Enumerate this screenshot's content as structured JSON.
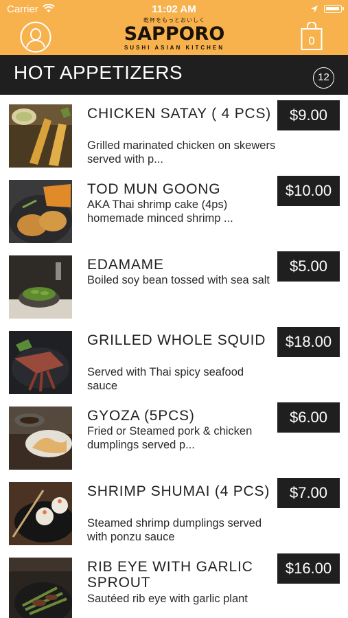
{
  "status_bar": {
    "carrier": "Carrier",
    "time": "11:02 AM"
  },
  "header": {
    "logo_jp": "乾杯をもっとおいしく",
    "logo_main": "SAPPORO",
    "logo_sub": "SUSHI ASIAN KITCHEN"
  },
  "section": {
    "title": "HOT APPETIZERS",
    "count": "12"
  },
  "items": [
    {
      "name": "CHICKEN SATAY ( 4 PCS)",
      "desc": "Grilled marinated chicken on skewers served with p...",
      "price": "$9.00"
    },
    {
      "name": "TOD MUN GOONG",
      "desc": "AKA Thai shrimp cake (4ps) homemade minced shrimp ...",
      "price": "$10.00"
    },
    {
      "name": "EDAMAME",
      "desc": "Boiled soy bean tossed with sea salt",
      "price": "$5.00"
    },
    {
      "name": "GRILLED WHOLE SQUID",
      "desc": "Served with Thai spicy seafood sauce",
      "price": "$18.00"
    },
    {
      "name": "GYOZA (5PCS)",
      "desc": "Fried or Steamed pork & chicken dumplings served p...",
      "price": "$6.00"
    },
    {
      "name": "SHRIMP SHUMAI (4 PCS)",
      "desc": "Steamed shrimp dumplings served with ponzu sauce",
      "price": "$7.00"
    },
    {
      "name": "RIB EYE WITH GARLIC SPROUT",
      "desc": "Sautéed rib eye with garlic plant",
      "price": "$16.00"
    }
  ]
}
